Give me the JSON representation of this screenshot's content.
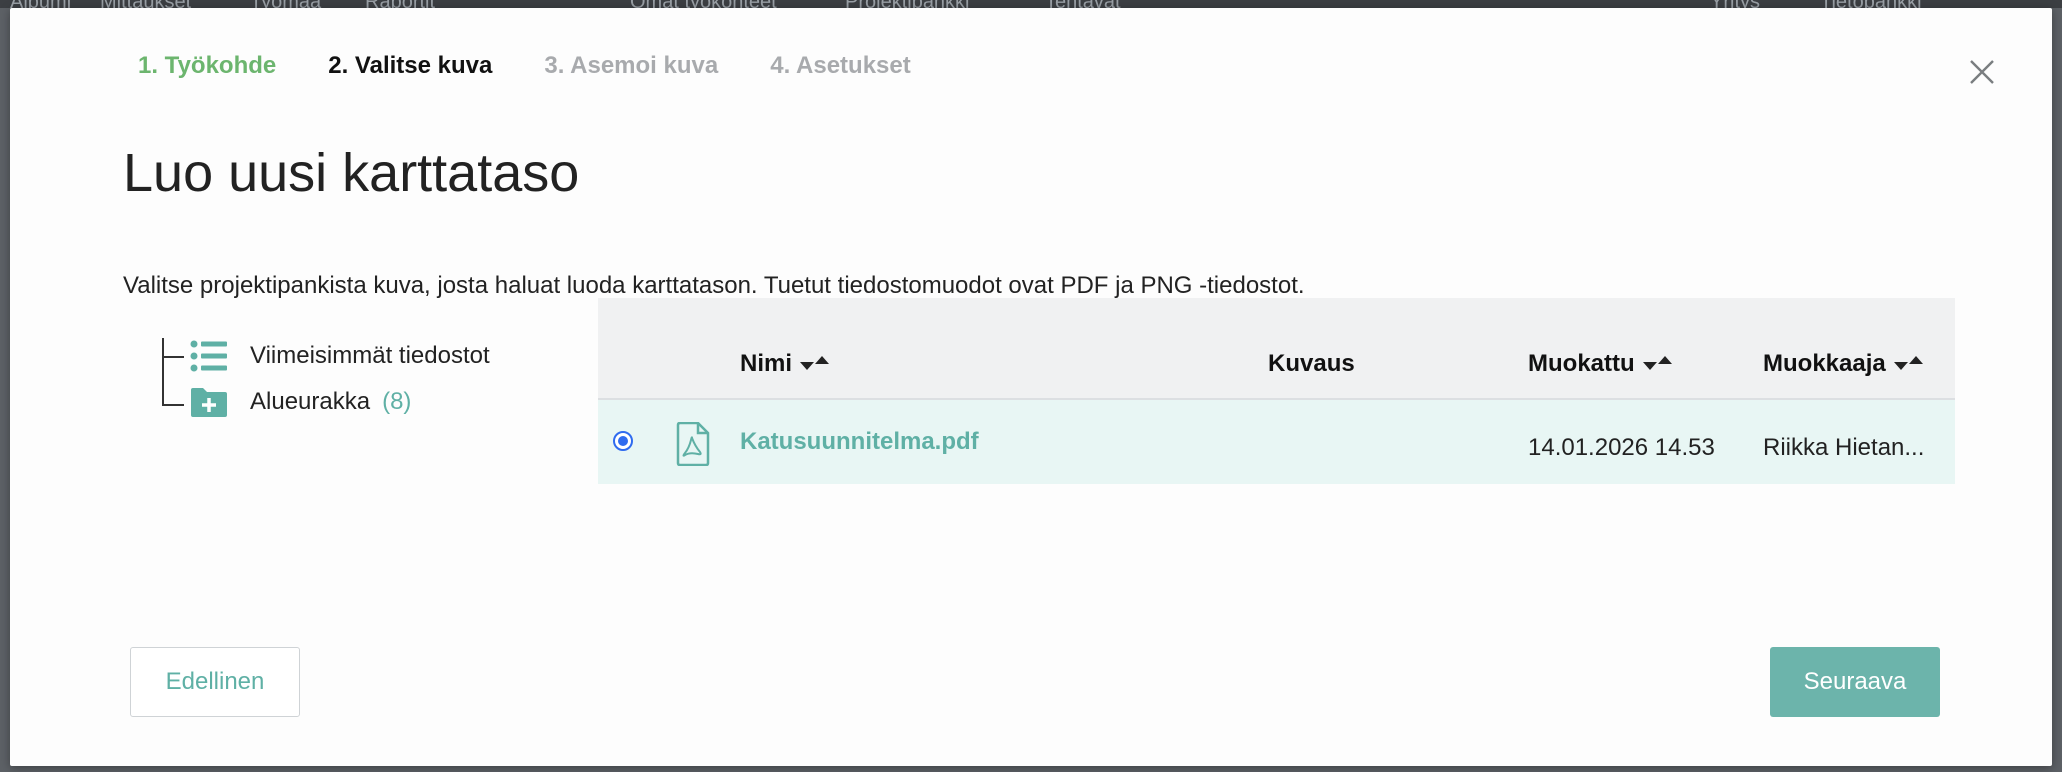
{
  "background_nav": [
    "Albumi",
    "Mittaukset",
    "Työmaa",
    "Raportit",
    "Omat työkohteet",
    "Projektipankki",
    "Tehtävät",
    "Yritys",
    "Tietopankki"
  ],
  "steps": [
    {
      "label": "1. Työkohde",
      "state": "done"
    },
    {
      "label": "2. Valitse kuva",
      "state": "active"
    },
    {
      "label": "3. Asemoi kuva",
      "state": "todo"
    },
    {
      "label": "4. Asetukset",
      "state": "todo"
    }
  ],
  "title": "Luo uusi karttataso",
  "description": "Valitse projektipankista kuva, josta haluat luoda karttatason. Tuetut tiedostomuodot ovat PDF ja PNG -tiedostot.",
  "tree": {
    "recent_label": "Viimeisimmät tiedostot",
    "folder_label": "Alueurakka",
    "folder_count": "(8)"
  },
  "table": {
    "columns": {
      "name": "Nimi",
      "description": "Kuvaus",
      "modified": "Muokattu",
      "editor": "Muokkaaja"
    },
    "rows": [
      {
        "name": "Katusuunnitelma.pdf",
        "description": "",
        "modified": "14.01.2026 14.53",
        "editor": "Riikka Hietan...",
        "selected": true
      }
    ]
  },
  "buttons": {
    "previous": "Edellinen",
    "next": "Seuraava"
  },
  "icons": {
    "close": "close-icon",
    "list": "list-icon",
    "folder": "folder-plus-icon",
    "file": "pdf-file-icon"
  },
  "colors": {
    "accent": "#5fb0a5",
    "done_step": "#6cb56e",
    "selected_row": "#e8f6f4",
    "next_button": "#6cb4ab"
  }
}
